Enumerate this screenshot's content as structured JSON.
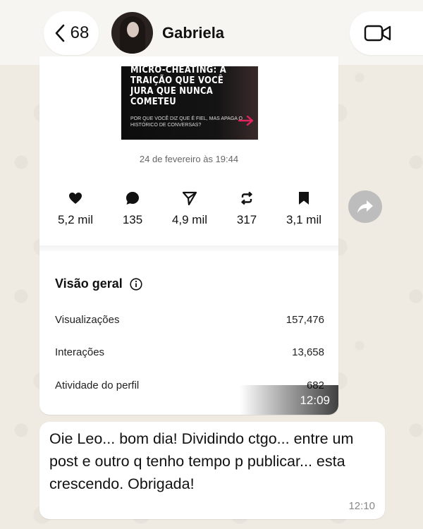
{
  "header": {
    "back_count": "68",
    "contact_name": "Gabriela"
  },
  "post": {
    "thumbnail": {
      "title": "MICRO-CHEATING: A TRAIÇÃO QUE VOCÊ JURA QUE NUNCA COMETEU",
      "subtitle": "POR QUE VOCÊ DIZ QUE É FIEL, MAS APAGA O HISTÓRICO DE CONVERSAS?",
      "accent_color": "#e0245e"
    },
    "date": "24 de fevereiro às 19:44",
    "stats": [
      {
        "icon": "heart-icon",
        "value": "5,2 mil"
      },
      {
        "icon": "comment-icon",
        "value": "135"
      },
      {
        "icon": "send-icon",
        "value": "4,9 mil"
      },
      {
        "icon": "repost-icon",
        "value": "317"
      },
      {
        "icon": "bookmark-icon",
        "value": "3,1 mil"
      }
    ],
    "overview": {
      "title": "Visão geral",
      "metrics": [
        {
          "label": "Visualizações",
          "value": "157,476"
        },
        {
          "label": "Interações",
          "value": "13,658"
        },
        {
          "label": "Atividade do perfil",
          "value": "682"
        }
      ]
    },
    "time": "12:09"
  },
  "message": {
    "text": "Oie Leo... bom dia! Dividindo ctgo... entre um post e outro q tenho tempo p publicar... esta crescendo. Obrigada!",
    "time": "12:10"
  }
}
